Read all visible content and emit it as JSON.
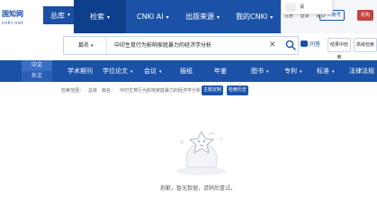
{
  "logo": {
    "text": "国知网",
    "sub": "cnki.net"
  },
  "topnav": {
    "db_select": "总库",
    "items": [
      {
        "label": "检索",
        "has_chevron": true
      },
      {
        "label": "CNKI AI",
        "has_chevron": true
      },
      {
        "label": "出版来源",
        "has_chevron": true
      },
      {
        "label": "我的CNKI",
        "has_chevron": true
      }
    ]
  },
  "user": {
    "toast_text": "请",
    "links": [
      "注册",
      "登录",
      "会员"
    ],
    "org_label": "机构",
    "reg_label": "个人账号"
  },
  "search": {
    "field": "篇名",
    "query": "中印生育行为影响家庭暴力的经济学分析",
    "qa_label": "问答",
    "adv_label": "结果中检索",
    "kw_label": "高级检索"
  },
  "lang": {
    "zh": "中文",
    "en": "外文"
  },
  "categories": [
    {
      "label": "学术期刊",
      "has_chevron": false
    },
    {
      "label": "学位论文",
      "has_chevron": true
    },
    {
      "label": "会议",
      "has_chevron": true
    },
    {
      "label": "报纸",
      "has_chevron": false
    },
    {
      "label": "年鉴",
      "has_chevron": false
    },
    {
      "label": "图书",
      "has_chevron": true
    },
    {
      "label": "专利",
      "has_chevron": true
    },
    {
      "label": "标准",
      "has_chevron": true
    },
    {
      "label": "法律法规",
      "has_chevron": false
    }
  ],
  "breadcrumb": {
    "scope_label": "检索范围：",
    "scope_value": "总库",
    "field_label": "篇名：",
    "field_value": "中印生育行为影响家庭暴力的经济学分析",
    "theme_btn": "主题定制",
    "history_btn": "检索历史"
  },
  "empty": {
    "message": "抱歉，暂无数据，请稍后重试。"
  },
  "colors": {
    "brand_blue": "#1b52a8",
    "active_blue": "#0d3f8d",
    "org_red": "#c2453d"
  }
}
